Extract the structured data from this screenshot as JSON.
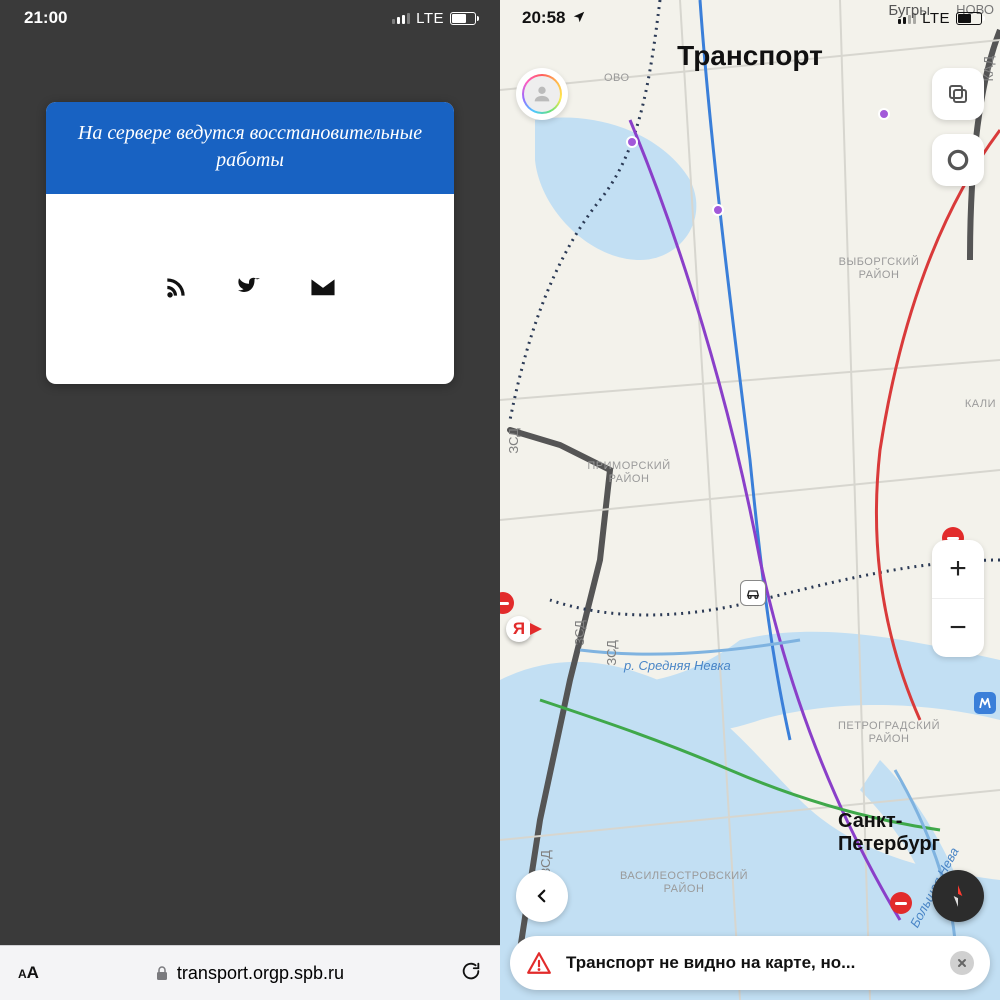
{
  "left": {
    "status": {
      "time": "21:00",
      "network": "LTE"
    },
    "card": {
      "message": "На сервере ведутся восстановительные работы",
      "icons": [
        "rss-icon",
        "twitter-icon",
        "mail-icon"
      ]
    },
    "browser": {
      "reader_label": "AA",
      "domain": "transport.orgp.spb.ru"
    }
  },
  "right": {
    "status": {
      "time": "20:58",
      "network": "LTE"
    },
    "title": "Транспорт",
    "zoom": {
      "plus": "+",
      "minus": "−"
    },
    "snackbar": {
      "text": "Транспорт не видно на карте, но..."
    },
    "map_labels": {
      "bugry": "Бугры",
      "novo": "НОВО",
      "ovo_suffix": "ОВО",
      "kad": "КАД",
      "vyborgsky": "ВЫБОРГСКИЙ РАЙОН",
      "kali": "КАЛИ",
      "primorsky": "ПРИМОРСКИЙ РАЙОН",
      "petrogradsky": "ПЕТРОГРАДСКИЙ РАЙОН",
      "vasileostrovsky": "ВАСИЛЕОСТРОВСКИЙ РАЙОН",
      "spb": "Санкт-Петербург",
      "zsd": "ЗСД",
      "neva_srednyaya": "р. Средняя Невка",
      "neva_bolshaya": "Большая Нева",
      "yandex_pin": "Я"
    }
  }
}
